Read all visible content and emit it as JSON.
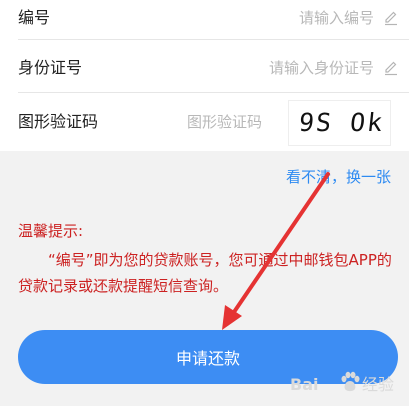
{
  "form": {
    "fields": [
      {
        "label": "编号",
        "placeholder": "请输入编号"
      },
      {
        "label": "身份证号",
        "placeholder": "请输入身份证号"
      },
      {
        "label": "图形验证码",
        "placeholder": "图形验证码"
      }
    ],
    "captcha_text": "9S Ok",
    "refresh_link": "看不清，换一张"
  },
  "tips": {
    "title": "温馨提示:",
    "body": "“编号”即为您的贷款账号，您可通过中邮钱包APP的贷款记录或还款提醒短信查询。"
  },
  "submit_label": "申请还款",
  "watermark": {
    "brand": "Bai",
    "suffix": "经验"
  },
  "icons": {
    "edit": "pencil-icon",
    "arrow": "red-arrow-annotation",
    "logo": "baidu-paw-logo"
  },
  "colors": {
    "accent": "#3d8df3",
    "link": "#2e8bf2",
    "tips": "#cc2222",
    "arrow": "#e53333"
  }
}
